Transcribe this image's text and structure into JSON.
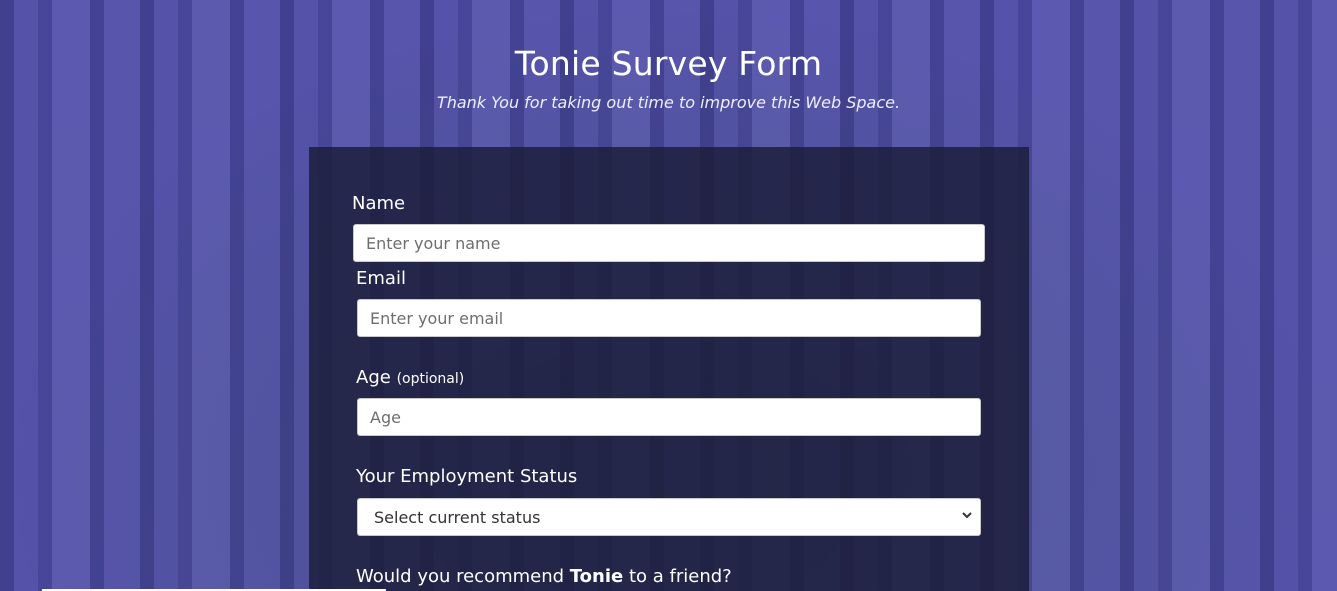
{
  "header": {
    "title": "Tonie Survey Form",
    "subtitle": "Thank You for taking out time to improve this Web Space."
  },
  "form": {
    "name": {
      "label": "Name",
      "placeholder": "Enter your name",
      "value": ""
    },
    "email": {
      "label": "Email",
      "placeholder": "Enter your email",
      "value": ""
    },
    "age": {
      "label": "Age",
      "optional": "(optional)",
      "placeholder": "Age",
      "value": ""
    },
    "employment": {
      "label": "Your Employment Status",
      "selected": "Select current status",
      "icon": "chevron-down-icon"
    },
    "recommend": {
      "label_pre": "Would you recommend ",
      "label_bold": "Tonie",
      "label_post": " to a friend?"
    }
  },
  "colors": {
    "background_tint": "#4a4a9a",
    "card": "#1b1c38",
    "text": "#ffffff"
  }
}
